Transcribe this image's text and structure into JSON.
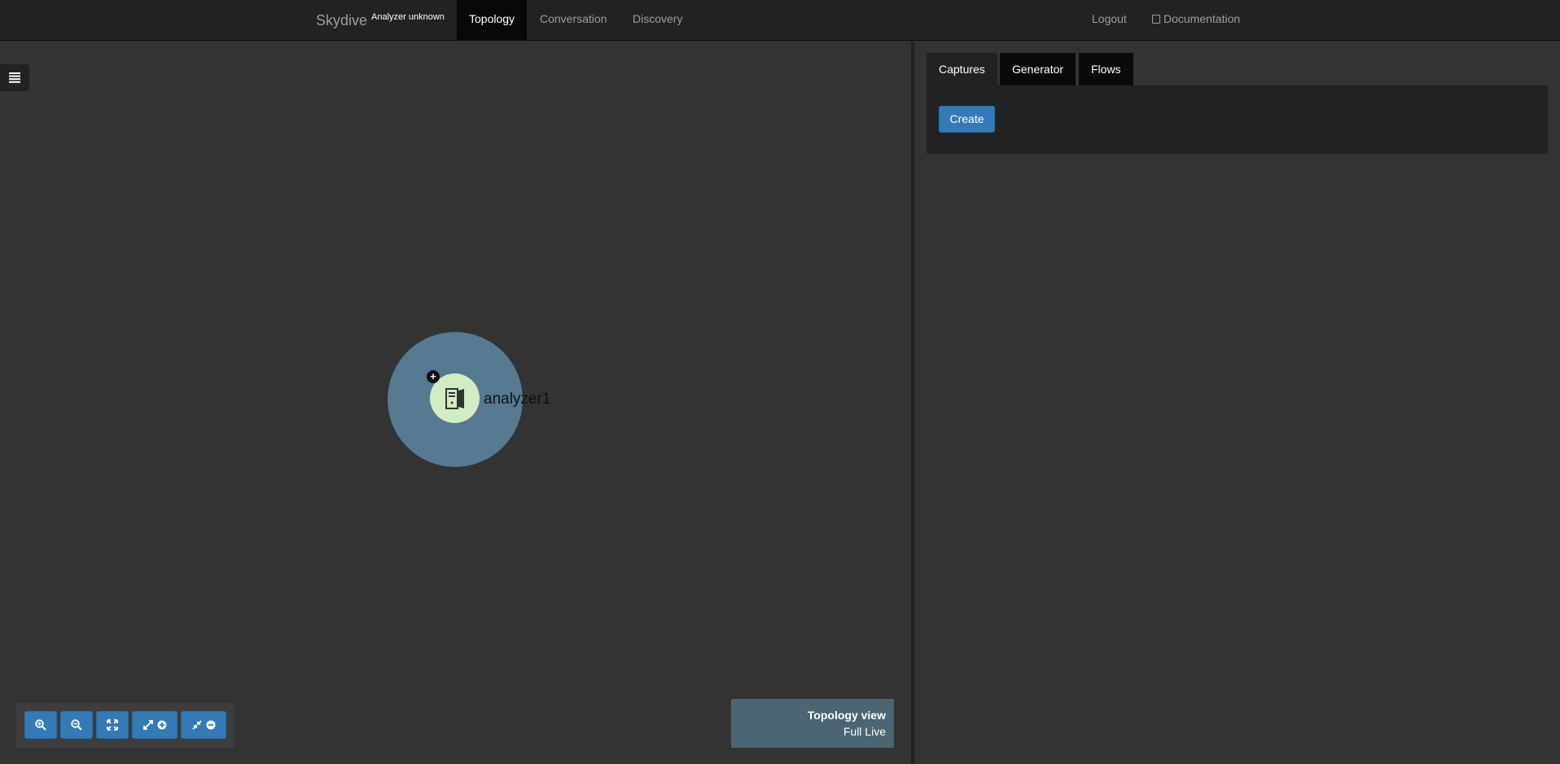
{
  "navbar": {
    "brand": "Skydive",
    "brand_sub": "Analyzer unknown",
    "items": [
      {
        "label": "Topology",
        "active": true
      },
      {
        "label": "Conversation",
        "active": false
      },
      {
        "label": "Discovery",
        "active": false
      }
    ],
    "logout": "Logout",
    "documentation": "Documentation"
  },
  "topology": {
    "node_label": "analyzer1",
    "node_icon": "server-icon",
    "expand_icon": "plus-icon",
    "menu_icon": "list-icon",
    "toolbar": [
      {
        "name": "zoom-in-button",
        "icon": "zoom-in-icon"
      },
      {
        "name": "zoom-out-button",
        "icon": "zoom-out-icon"
      },
      {
        "name": "zoom-fit-button",
        "icon": "fullscreen-icon"
      },
      {
        "name": "expand-all-button",
        "icon": "expand-plus-icon"
      },
      {
        "name": "collapse-all-button",
        "icon": "collapse-minus-icon"
      }
    ],
    "view_title": "Topology view",
    "view_mode": "Full Live"
  },
  "right_panel": {
    "tabs": [
      {
        "label": "Captures",
        "active": true
      },
      {
        "label": "Generator",
        "active": false
      },
      {
        "label": "Flows",
        "active": false
      }
    ],
    "create_label": "Create"
  },
  "colors": {
    "background": "#333333",
    "navbar": "#222222",
    "group_circle": "#557a92",
    "node_circle": "#d2ecc3",
    "primary_button": "#337ab7"
  }
}
